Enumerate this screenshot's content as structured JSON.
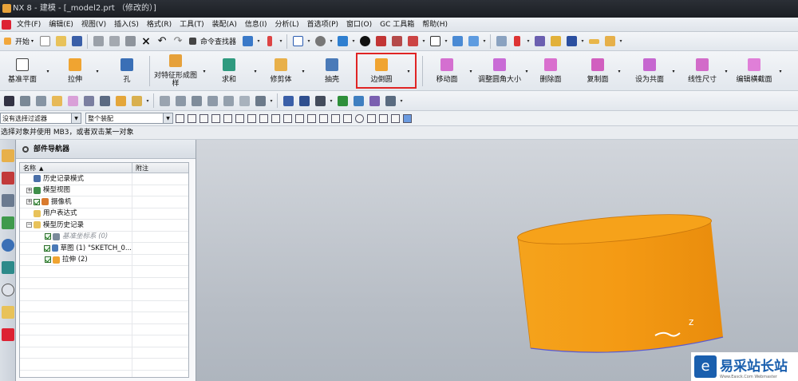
{
  "window": {
    "title": "NX 8 - 建模 - [_model2.prt （修改的）]"
  },
  "menu": [
    "文件(F)",
    "编辑(E)",
    "视图(V)",
    "插入(S)",
    "格式(R)",
    "工具(T)",
    "装配(A)",
    "信息(I)",
    "分析(L)",
    "首选项(P)",
    "窗口(O)",
    "GC 工具箱",
    "帮助(H)"
  ],
  "standard_toolbar": {
    "start_label": "开始",
    "command_finder_label": "命令查找器"
  },
  "feature_toolbar": [
    {
      "label": "基准平面",
      "icon": "datum-plane-icon"
    },
    {
      "label": "拉伸",
      "icon": "extrude-icon"
    },
    {
      "label": "孔",
      "icon": "hole-icon"
    },
    {
      "label": "对特征形成图样",
      "icon": "pattern-feature-icon"
    },
    {
      "label": "求和",
      "icon": "unite-icon"
    },
    {
      "label": "修剪体",
      "icon": "trim-body-icon"
    },
    {
      "label": "抽壳",
      "icon": "shell-icon"
    },
    {
      "label": "边倒圆",
      "icon": "edge-blend-icon"
    },
    {
      "label": "移动面",
      "icon": "move-face-icon"
    },
    {
      "label": "调整圆角大小",
      "icon": "resize-blend-icon"
    },
    {
      "label": "删除面",
      "icon": "delete-face-icon"
    },
    {
      "label": "复制面",
      "icon": "copy-face-icon"
    },
    {
      "label": "设为共面",
      "icon": "make-coplanar-icon"
    },
    {
      "label": "线性尺寸",
      "icon": "linear-dimension-icon"
    },
    {
      "label": "编辑横截面",
      "icon": "edit-section-icon"
    }
  ],
  "selection_bar": {
    "filter": "没有选择过滤器",
    "scope": "整个装配"
  },
  "status_text": "选择对象并使用 MB3，或者双击某一对象",
  "navigator": {
    "title": "部件导航器",
    "columns": {
      "name": "名称",
      "note": "附注"
    },
    "rows": [
      {
        "label": "历史记录模式",
        "expander": "",
        "check": false,
        "gray": false
      },
      {
        "label": "模型视图",
        "expander": "+",
        "check": false,
        "gray": false
      },
      {
        "label": "摄像机",
        "expander": "+",
        "check": true,
        "gray": false
      },
      {
        "label": "用户表达式",
        "expander": "",
        "check": false,
        "gray": false
      },
      {
        "label": "模型历史记录",
        "expander": "−",
        "check": false,
        "gray": false
      },
      {
        "label": "基准坐标系 (0)",
        "expander": "",
        "check": true,
        "gray": true
      },
      {
        "label": "草图 (1) \"SKETCH_0...",
        "expander": "",
        "check": true,
        "gray": false
      },
      {
        "label": "拉伸 (2)",
        "expander": "",
        "check": true,
        "gray": false
      }
    ]
  },
  "watermark": {
    "brand": "易采站长站",
    "url": "Www.Easck.Com Webmaster"
  },
  "colors": {
    "highlight": "#e02424",
    "cylinder": "#f29a1a",
    "canvas_top": "#d2d6dc"
  }
}
